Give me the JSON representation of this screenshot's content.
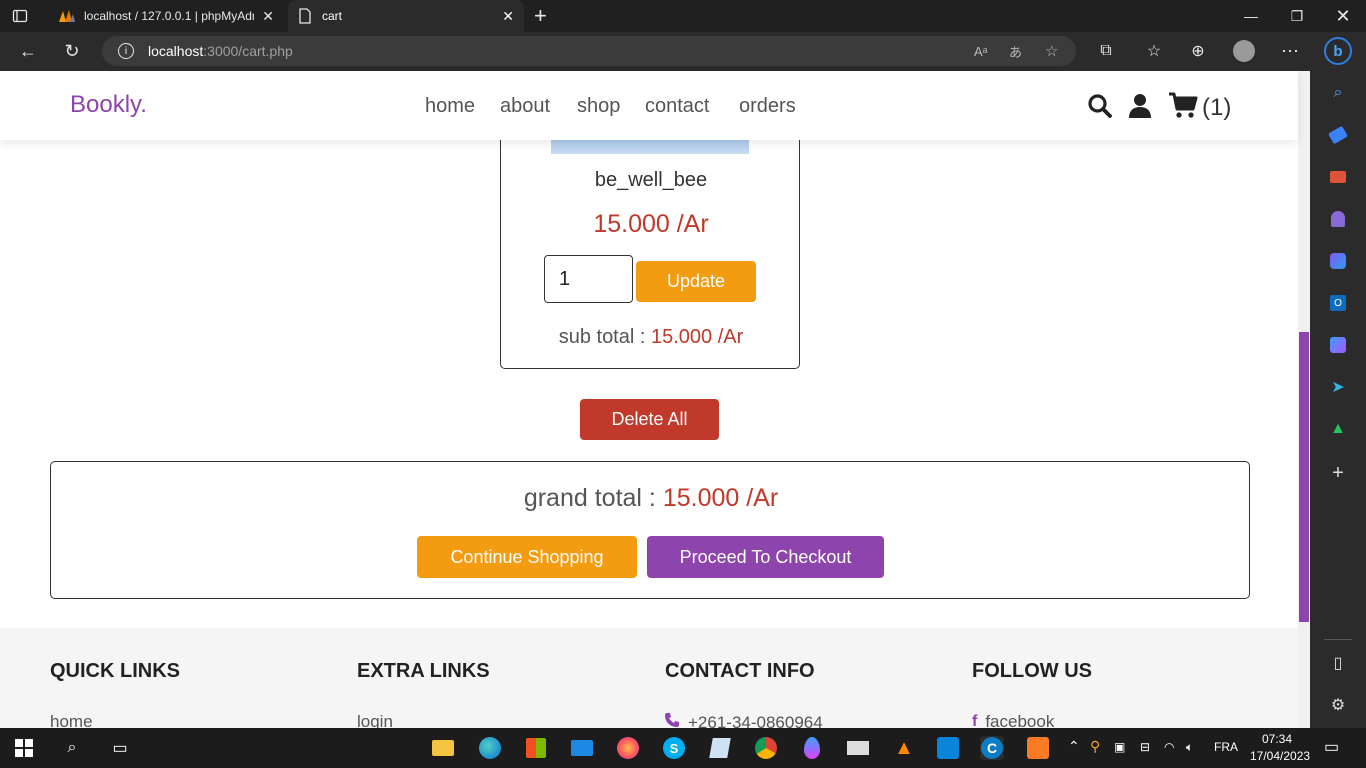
{
  "browser": {
    "tabs": [
      {
        "label": "localhost / 127.0.0.1 | phpMyAdmin",
        "icon": "phpmyadmin-icon"
      },
      {
        "label": "cart",
        "icon": "page-icon"
      }
    ],
    "url_host": "localhost",
    "url_path": ":3000/cart.php"
  },
  "site": {
    "logo": "Bookly.",
    "nav": [
      "home",
      "about",
      "shop",
      "contact",
      "orders"
    ],
    "cart_count": "(1)"
  },
  "cart": {
    "product_name": "be_well_bee",
    "price": "15.000 /Ar",
    "quantity": "1",
    "update_label": "Update",
    "subtotal_label": "sub total :",
    "subtotal_value": "15.000 /Ar",
    "delete_all_label": "Delete All"
  },
  "totals": {
    "grand_total_label": "grand total :",
    "grand_total_value": "15.000 /Ar",
    "continue_label": "Continue Shopping",
    "checkout_label": "Proceed To Checkout"
  },
  "footer": {
    "columns": [
      {
        "title": "QUICK LINKS",
        "first_link": "home"
      },
      {
        "title": "EXTRA LINKS",
        "first_link": "login"
      },
      {
        "title": "CONTACT INFO",
        "first_link": "+261-34-0860964"
      },
      {
        "title": "FOLLOW US",
        "first_link": "facebook"
      }
    ]
  },
  "taskbar": {
    "language": "FRA",
    "time": "07:34",
    "date": "17/04/2023"
  },
  "colors": {
    "brand": "#8e44ad",
    "orange": "#f39c12",
    "red": "#c0392b"
  }
}
